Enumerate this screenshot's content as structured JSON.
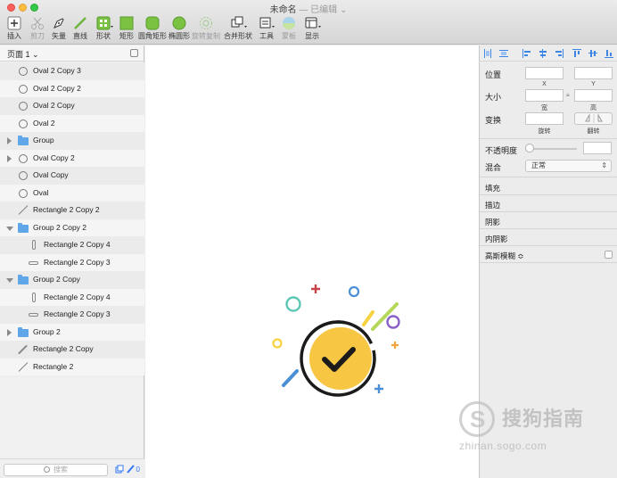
{
  "window": {
    "title": "未命名",
    "subtitle": "— 已编辑"
  },
  "toolbar": {
    "items": [
      {
        "label": "插入",
        "icon": "plus-icon"
      },
      {
        "label": "剪刀",
        "icon": "scissors-icon"
      },
      {
        "label": "矢量",
        "icon": "pen-icon"
      },
      {
        "label": "直线",
        "icon": "line-icon"
      },
      {
        "label": "形状",
        "icon": "shapes-icon"
      },
      {
        "label": "矩形",
        "icon": "rectangle-icon"
      },
      {
        "label": "圆角矩形",
        "icon": "rounded-rectangle-icon"
      },
      {
        "label": "椭圆形",
        "icon": "oval-icon"
      },
      {
        "label": "旋转复制",
        "icon": "rotate-copy-icon"
      },
      {
        "label": "合并形状",
        "icon": "combine-shapes-icon"
      },
      {
        "label": "工具",
        "icon": "tools-icon"
      },
      {
        "label": "蒙板",
        "icon": "mask-icon"
      },
      {
        "label": "显示",
        "icon": "display-icon"
      }
    ]
  },
  "sidebar": {
    "page_label": "页面 1",
    "layers": [
      {
        "name": "Oval 2 Copy 3",
        "icon": "oval-icon"
      },
      {
        "name": "Oval 2 Copy 2",
        "icon": "oval-icon"
      },
      {
        "name": "Oval 2 Copy",
        "icon": "oval-icon"
      },
      {
        "name": "Oval 2",
        "icon": "oval-icon"
      },
      {
        "name": "Group",
        "icon": "folder-icon"
      },
      {
        "name": "Oval Copy 2",
        "icon": "oval-icon"
      },
      {
        "name": "Oval Copy",
        "icon": "oval-icon"
      },
      {
        "name": "Oval",
        "icon": "oval-icon"
      },
      {
        "name": "Rectangle 2 Copy 2",
        "icon": "line-icon"
      },
      {
        "name": "Group 2 Copy 2",
        "icon": "folder-icon"
      },
      {
        "name": "Rectangle 2 Copy 4",
        "icon": "vertical-rect-icon"
      },
      {
        "name": "Rectangle 2 Copy 3",
        "icon": "horizontal-rect-icon"
      },
      {
        "name": "Group 2 Copy",
        "icon": "folder-icon"
      },
      {
        "name": "Rectangle 2 Copy 4",
        "icon": "vertical-rect-icon"
      },
      {
        "name": "Rectangle 2 Copy 3",
        "icon": "horizontal-rect-icon"
      },
      {
        "name": "Group 2",
        "icon": "folder-icon"
      },
      {
        "name": "Rectangle 2 Copy",
        "icon": "pencil-icon"
      },
      {
        "name": "Rectangle 2",
        "icon": "line-icon"
      }
    ],
    "search_placeholder": "搜索",
    "footer_count": "0"
  },
  "inspector": {
    "position_label": "位置",
    "x_label": "X",
    "y_label": "Y",
    "size_label": "大小",
    "width_label": "宽",
    "height_label": "高",
    "transform_label": "变换",
    "rotate_label": "旋转",
    "flip_label": "翻转",
    "opacity_label": "不透明度",
    "blend_label": "混合",
    "blend_value": "正常",
    "fill_label": "填充",
    "border_label": "描边",
    "shadow_label": "阴影",
    "inner_shadow_label": "内阴影",
    "blur_label": "高斯模糊 ≎"
  },
  "watermark": {
    "title": "搜狗指南",
    "url": "zhinan.sogo.com"
  },
  "colors": {
    "accent": "#3d86e6",
    "badge_yellow": "#f7c744",
    "badge_stroke": "#1b1b1b",
    "confetti_teal": "#5dc7b6",
    "confetti_red": "#c7444a",
    "confetti_blue": "#4b8fd6",
    "confetti_purple": "#8b5fc8",
    "confetti_orange": "#f2a33a",
    "confetti_green": "#b5d85a"
  }
}
